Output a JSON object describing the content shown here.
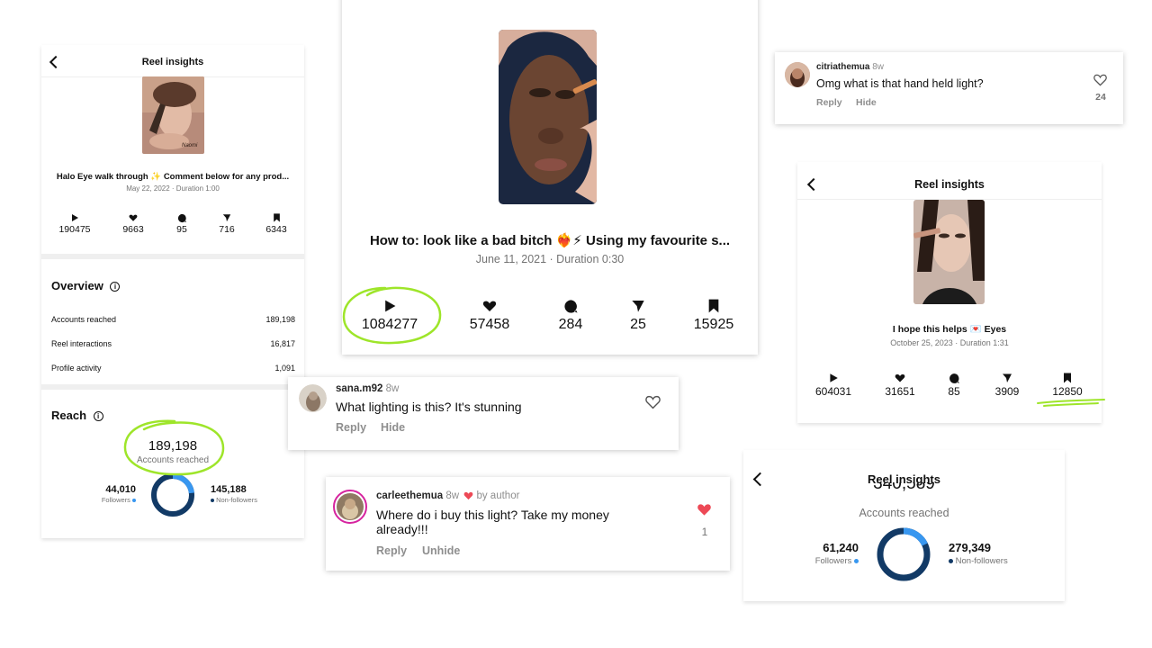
{
  "panel1": {
    "title": "Reel insights",
    "caption": "Halo Eye walk through ✨ Comment below for any prod...",
    "date_line": "May 22, 2022 · Duration 1:00",
    "stats": {
      "plays": "190475",
      "likes": "9663",
      "comments": "95",
      "shares": "716",
      "saves": "6343"
    },
    "overview_title": "Overview",
    "rows": [
      {
        "label": "Accounts reached",
        "value": "189,198"
      },
      {
        "label": "Reel interactions",
        "value": "16,817"
      },
      {
        "label": "Profile activity",
        "value": "1,091"
      }
    ],
    "reach_title": "Reach",
    "reach_value": "189,198",
    "reach_label": "Accounts reached",
    "followers_value": "44,010",
    "followers_label": "Followers",
    "nonfollowers_value": "145,188",
    "nonfollowers_label": "Non-followers",
    "followers_fraction": 0.233
  },
  "panel2": {
    "caption": "How to: look like a bad bitch ❤️‍🔥⚡ Using my favourite s...",
    "date_line": "June 11, 2021 · Duration 0:30",
    "stats": {
      "plays": "1084277",
      "likes": "57458",
      "comments": "284",
      "shares": "25",
      "saves": "15925"
    }
  },
  "comment_top": {
    "user": "citriathemua",
    "time": "8w",
    "text": "Omg what is that hand held light?",
    "reply": "Reply",
    "hide": "Hide",
    "likes": "24"
  },
  "comment_sana": {
    "user": "sana.m92",
    "time": "8w",
    "text": "What lighting is this? It's stunning",
    "reply": "Reply",
    "hide": "Hide"
  },
  "comment_carlee": {
    "user": "carleethemua",
    "time": "8w",
    "by_author": "by author",
    "text": "Where do i buy this light? Take my money already!!!",
    "reply": "Reply",
    "unhide": "Unhide",
    "likes": "1"
  },
  "panel_right": {
    "title": "Reel insights",
    "caption": "I hope this helps 💌 Eyes",
    "date_line": "October 25, 2023 · Duration 1:31",
    "stats": {
      "plays": "604031",
      "likes": "31651",
      "comments": "85",
      "shares": "3909",
      "saves": "12850"
    }
  },
  "panel_bottom": {
    "title": "Reel insights",
    "reach_value_partial": "340,589",
    "reach_label": "Accounts reached",
    "followers_value": "61,240",
    "followers_label": "Followers",
    "nonfollowers_value": "279,349",
    "nonfollowers_label": "Non-followers",
    "followers_fraction": 0.18
  },
  "colors": {
    "highlight_green": "#9ee52a",
    "followers_blue": "#3897f0",
    "donut_navy": "#123a66",
    "heart_red": "#ed4956"
  }
}
